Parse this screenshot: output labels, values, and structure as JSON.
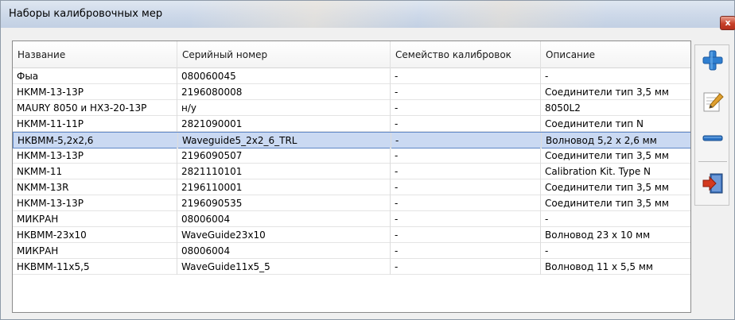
{
  "window": {
    "title": "Наборы калибровочных мер",
    "close_label": "x"
  },
  "table": {
    "columns": [
      "Название",
      "Серийный номер",
      "Семейство калибровок",
      "Описание"
    ],
    "rows": [
      [
        "Фыа",
        "080060045",
        "-",
        "-"
      ],
      [
        "HKMM-13-13P",
        "2196080008",
        "-",
        "Соединители тип 3,5 мм"
      ],
      [
        "MAURY 8050 и HX3-20-13P",
        "н/у",
        "-",
        "8050L2"
      ],
      [
        "HKMM-11-11P",
        "2821090001",
        "-",
        "Соединители тип N"
      ],
      [
        "HKBMM-5,2x2,6",
        "Waveguide5_2x2_6_TRL",
        "-",
        "Волновод 5,2 x 2,6 мм"
      ],
      [
        "HKMM-13-13P",
        "2196090507",
        "-",
        "Соединители тип 3,5 мм"
      ],
      [
        "NKMM-11",
        "2821110101",
        "-",
        "Calibration Kit. Type N"
      ],
      [
        "NKMM-13R",
        "2196110001",
        "-",
        "Соединители тип 3,5 мм"
      ],
      [
        "HKMM-13-13P",
        "2196090535",
        "-",
        "Соединители тип 3,5 мм"
      ],
      [
        "МИКРАН",
        "08006004",
        "-",
        "-"
      ],
      [
        "HKBMM-23x10",
        "WaveGuide23x10",
        "-",
        "Волновод 23 x 10 мм"
      ],
      [
        "МИКРАН",
        "08006004",
        "-",
        "-"
      ],
      [
        "HKBMM-11x5,5",
        "WaveGuide11x5_5",
        "-",
        "Волновод 11 x 5,5 мм"
      ]
    ],
    "selected_row": 4
  },
  "toolbar": {
    "buttons": [
      {
        "icon": "add-icon",
        "color": "#2f7fd0"
      },
      {
        "icon": "edit-icon",
        "color": "#e0a030"
      },
      {
        "icon": "remove-icon",
        "color": "#2a72c4"
      },
      {
        "icon": "exit-icon",
        "color": "#d43a1f"
      }
    ]
  }
}
